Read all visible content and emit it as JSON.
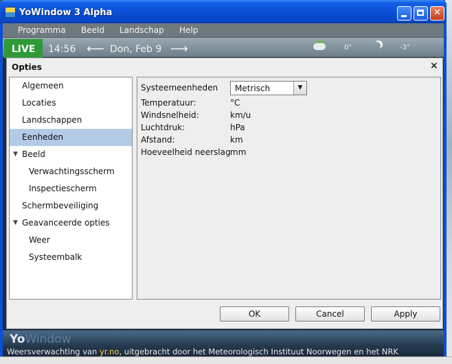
{
  "window": {
    "title": "YoWindow 3 Alpha"
  },
  "menu": [
    "Programma",
    "Beeld",
    "Landschap",
    "Help"
  ],
  "weather_bar": {
    "live": "LIVE",
    "time": "14:56",
    "date": "Don, Feb 9",
    "temps": [
      "0°",
      "-3°"
    ]
  },
  "dialog": {
    "title": "Opties",
    "close": "×",
    "categories": [
      {
        "label": "Algemeen",
        "indent": 0,
        "selected": false,
        "expandable": false
      },
      {
        "label": "Locaties",
        "indent": 0,
        "selected": false,
        "expandable": false
      },
      {
        "label": "Landschappen",
        "indent": 0,
        "selected": false,
        "expandable": false
      },
      {
        "label": "Eenheden",
        "indent": 0,
        "selected": true,
        "expandable": false
      },
      {
        "label": "Beeld",
        "indent": 0,
        "selected": false,
        "expandable": true
      },
      {
        "label": "Verwachtingsscherm",
        "indent": 1,
        "selected": false,
        "expandable": false
      },
      {
        "label": "Inspectiescherm",
        "indent": 1,
        "selected": false,
        "expandable": false
      },
      {
        "label": "Schermbeveiliging",
        "indent": 0,
        "selected": false,
        "expandable": false
      },
      {
        "label": "Geavanceerde opties",
        "indent": 0,
        "selected": false,
        "expandable": true
      },
      {
        "label": "Weer",
        "indent": 1,
        "selected": false,
        "expandable": false
      },
      {
        "label": "Systeembalk",
        "indent": 1,
        "selected": false,
        "expandable": false
      }
    ],
    "units": {
      "system_label": "Systeemeenheden",
      "system_value": "Metrisch",
      "rows": [
        {
          "label": "Temperatuur:",
          "value": "°C"
        },
        {
          "label": "Windsnelheid:",
          "value": "km/u"
        },
        {
          "label": "Luchtdruk:",
          "value": "hPa"
        },
        {
          "label": "Afstand:",
          "value": "km"
        },
        {
          "label": "Hoeveelheid neerslag",
          "value": "mm"
        }
      ]
    },
    "buttons": {
      "ok": "OK",
      "cancel": "Cancel",
      "apply": "Apply"
    }
  },
  "footer": {
    "logo_strong": "Yo",
    "logo_faint": "Window",
    "credit_before": "Weersverwachting van ",
    "credit_link": "yr.no",
    "credit_after": ", uitgebracht door het Meteorologisch Instituut Noorwegen en het NRK"
  }
}
